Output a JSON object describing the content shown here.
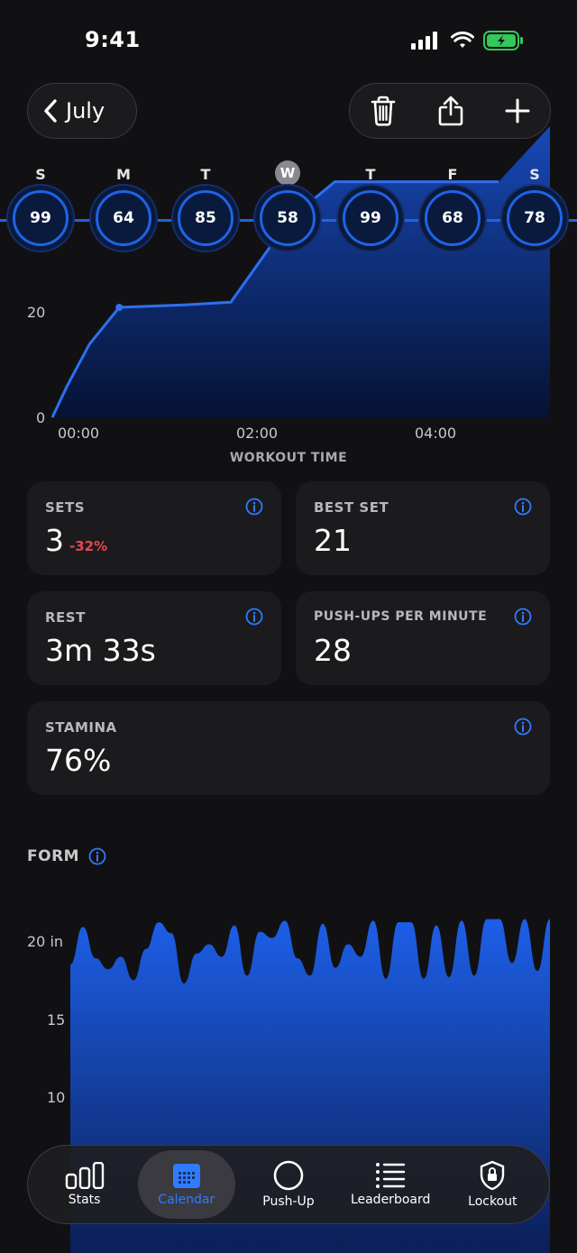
{
  "status": {
    "time": "9:41"
  },
  "header": {
    "back_label": "July"
  },
  "week": {
    "days": [
      {
        "letter": "S",
        "value": "99"
      },
      {
        "letter": "M",
        "value": "64"
      },
      {
        "letter": "T",
        "value": "85"
      },
      {
        "letter": "W",
        "value": "58",
        "today": true
      },
      {
        "letter": "T",
        "value": "99"
      },
      {
        "letter": "F",
        "value": "68"
      },
      {
        "letter": "S",
        "value": "78"
      }
    ]
  },
  "workout_chart": {
    "caption": "WORKOUT TIME",
    "y_ticks": [
      "20",
      "0"
    ],
    "x_ticks": [
      "00:00",
      "02:00",
      "04:00"
    ]
  },
  "chart_data": [
    {
      "type": "area",
      "xlabel": "WORKOUT TIME",
      "ylabel": "",
      "x_ticks": [
        "00:00",
        "02:00",
        "04:00"
      ],
      "y_ticks": [
        0,
        20
      ],
      "points": [
        {
          "x": "00:00",
          "y": 0
        },
        {
          "x": "00:10",
          "y": 6
        },
        {
          "x": "00:25",
          "y": 14
        },
        {
          "x": "00:45",
          "y": 21
        },
        {
          "x": "01:30",
          "y": 21.5
        },
        {
          "x": "02:00",
          "y": 22
        },
        {
          "x": "02:20",
          "y": 30
        },
        {
          "x": "02:40",
          "y": 38
        },
        {
          "x": "03:10",
          "y": 45
        },
        {
          "x": "04:00",
          "y": 45
        },
        {
          "x": "05:00",
          "y": 45
        }
      ]
    },
    {
      "type": "area",
      "title": "FORM",
      "ylabel": "in",
      "y_ticks": [
        "20 in",
        "15",
        "10"
      ],
      "ylim": [
        5,
        22
      ],
      "values": [
        18.5,
        20.9,
        18.9,
        18.2,
        19.0,
        17.5,
        19.5,
        21.2,
        20.5,
        17.3,
        19.2,
        19.8,
        19.0,
        21.0,
        17.8,
        20.6,
        20.2,
        21.3,
        18.9,
        17.8,
        21.1,
        18.3,
        19.8,
        19.0,
        21.3,
        17.6,
        21.2,
        21.2,
        17.6,
        21.0,
        17.7,
        21.3,
        17.8,
        21.4,
        21.4,
        18.6,
        21.4,
        18.1,
        21.4
      ]
    }
  ],
  "stats": {
    "sets": {
      "title": "SETS",
      "value": "3",
      "delta": "-32%"
    },
    "best_set": {
      "title": "BEST SET",
      "value": "21"
    },
    "rest": {
      "title": "REST",
      "value": "3m 33s"
    },
    "ppm": {
      "title": "PUSH-UPS PER MINUTE",
      "value": "28"
    },
    "stamina": {
      "title": "STAMINA",
      "value": "76%"
    }
  },
  "form": {
    "title": "FORM"
  },
  "tabbar": {
    "tabs": [
      {
        "label": "Stats",
        "icon": "bar-chart-icon"
      },
      {
        "label": "Calendar",
        "icon": "calendar-icon",
        "active": true
      },
      {
        "label": "Push-Up",
        "icon": "circle-icon"
      },
      {
        "label": "Leaderboard",
        "icon": "list-icon"
      },
      {
        "label": "Lockout",
        "icon": "lock-shield-icon"
      }
    ]
  },
  "colors": {
    "accent": "#1f63e6",
    "accent_text": "#2f7bff",
    "negative": "#e5484d",
    "card": "#1b1b1e",
    "bg": "#111113"
  }
}
